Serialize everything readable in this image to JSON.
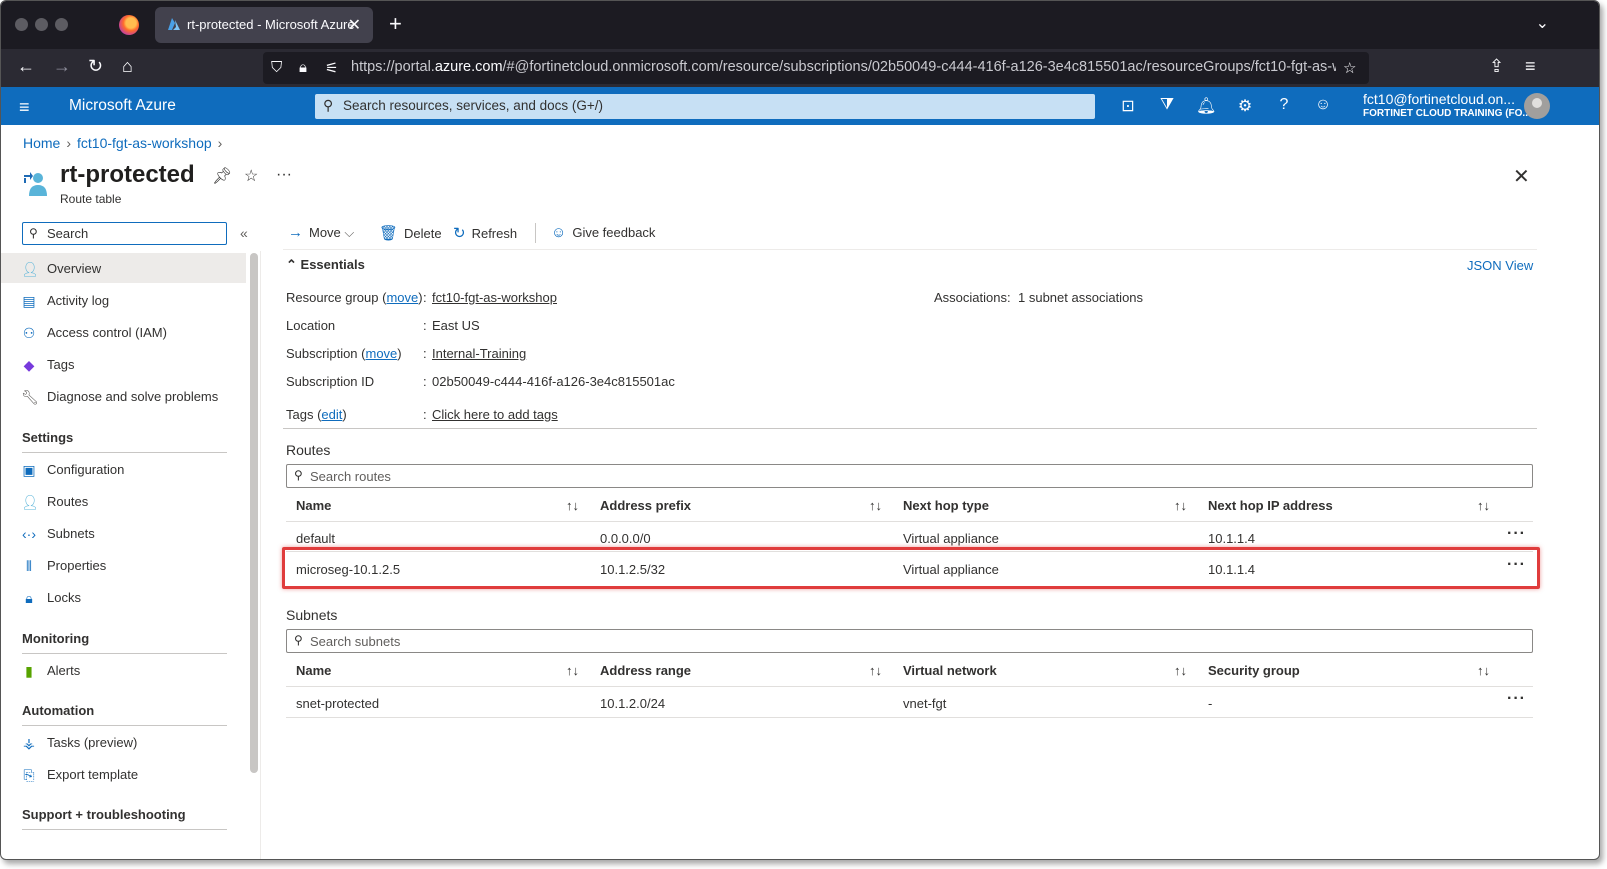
{
  "browser": {
    "tab_title": "rt-protected - Microsoft Azure",
    "url_prefix": "https://portal.",
    "url_domain": "azure.com",
    "url_rest": "/#@fortinetcloud.onmicrosoft.com/resource/subscriptions/02b50049-c444-416f-a126-3e4c815501ac/resourceGroups/fct10-fgt-as-w"
  },
  "azure": {
    "brand": "Microsoft Azure",
    "search_placeholder": "Search resources, services, and docs (G+/)",
    "account_email": "fct10@fortinetcloud.on...",
    "account_org": "FORTINET CLOUD TRAINING (FO..."
  },
  "breadcrumb": {
    "home": "Home",
    "group": "fct10-fgt-as-workshop"
  },
  "resource": {
    "title": "rt-protected",
    "subtitle": "Route table"
  },
  "sidebar": {
    "search_placeholder": "Search",
    "items": [
      {
        "label": "Overview",
        "icon": "overview-icon"
      },
      {
        "label": "Activity log",
        "icon": "activity-log-icon"
      },
      {
        "label": "Access control (IAM)",
        "icon": "iam-icon"
      },
      {
        "label": "Tags",
        "icon": "tag-icon"
      },
      {
        "label": "Diagnose and solve problems",
        "icon": "wrench-icon"
      }
    ],
    "settings_title": "Settings",
    "settings": [
      {
        "label": "Configuration",
        "icon": "configuration-icon"
      },
      {
        "label": "Routes",
        "icon": "routes-icon"
      },
      {
        "label": "Subnets",
        "icon": "subnets-icon"
      },
      {
        "label": "Properties",
        "icon": "properties-icon"
      },
      {
        "label": "Locks",
        "icon": "lock-icon"
      }
    ],
    "monitoring_title": "Monitoring",
    "monitoring": [
      {
        "label": "Alerts",
        "icon": "alerts-icon"
      }
    ],
    "automation_title": "Automation",
    "automation": [
      {
        "label": "Tasks (preview)",
        "icon": "tasks-icon"
      },
      {
        "label": "Export template",
        "icon": "export-template-icon"
      }
    ],
    "support_title": "Support + troubleshooting"
  },
  "commands": {
    "move": "Move",
    "delete": "Delete",
    "refresh": "Refresh",
    "feedback": "Give feedback"
  },
  "essentials": {
    "title": "Essentials",
    "json_view": "JSON View",
    "resource_group_label": "Resource group (",
    "move_link": "move",
    "close_paren": ")",
    "resource_group_value": "fct10-fgt-as-workshop",
    "location_label": "Location",
    "location_value": "East US",
    "subscription_label": "Subscription (",
    "subscription_value": "Internal-Training",
    "subscription_id_label": "Subscription ID",
    "subscription_id_value": "02b50049-c444-416f-a126-3e4c815501ac",
    "tags_label": "Tags (",
    "edit_link": "edit",
    "tags_value": "Click here to add tags",
    "associations_label": "Associations",
    "associations_value": "1 subnet associations",
    "colon": ":"
  },
  "routes": {
    "title": "Routes",
    "search_placeholder": "Search routes",
    "columns": [
      "Name",
      "Address prefix",
      "Next hop type",
      "Next hop IP address"
    ],
    "rows": [
      [
        "default",
        "0.0.0.0/0",
        "Virtual appliance",
        "10.1.1.4"
      ],
      [
        "microseg-10.1.2.5",
        "10.1.2.5/32",
        "Virtual appliance",
        "10.1.1.4"
      ]
    ]
  },
  "subnets": {
    "title": "Subnets",
    "search_placeholder": "Search subnets",
    "columns": [
      "Name",
      "Address range",
      "Virtual network",
      "Security group"
    ],
    "rows": [
      [
        "snet-protected",
        "10.1.2.0/24",
        "vnet-fgt",
        "-"
      ]
    ]
  },
  "colors": {
    "accent": "#0f6cbd",
    "highlight": "#e03c3c"
  }
}
